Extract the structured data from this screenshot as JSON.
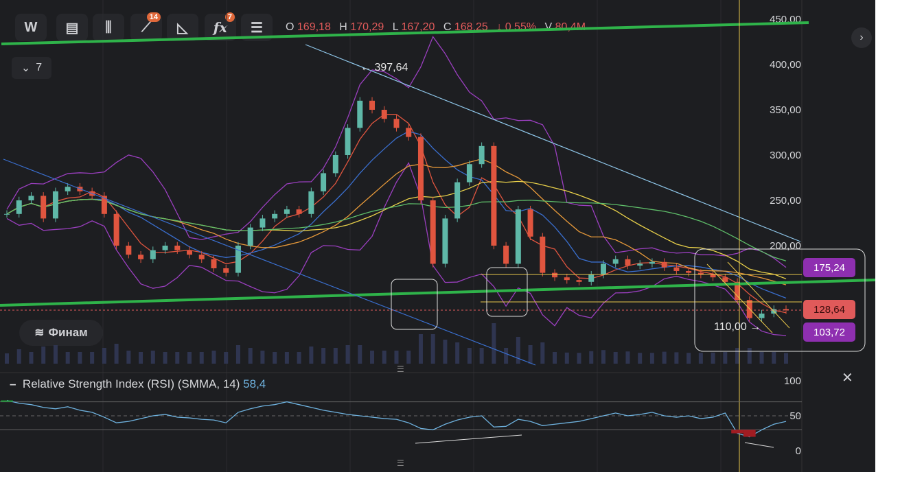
{
  "toolbar": {
    "interval": "W",
    "indicators_badge": "14",
    "fx_badge": "7"
  },
  "ohlc": {
    "o_label": "O",
    "o": "169,18",
    "h_label": "H",
    "h": "170,29",
    "l_label": "L",
    "l": "167,20",
    "c_label": "C",
    "c": "168,25",
    "change": "↓ 0,55%",
    "v_label": "V",
    "v": "80,4M"
  },
  "collapse": {
    "label": "7"
  },
  "logo": "Финам",
  "price_axis": [
    "450,00",
    "400,00",
    "350,00",
    "300,00",
    "250,00",
    "200,00"
  ],
  "price_tags": [
    {
      "value": "175,24",
      "color": "#8e2fb0"
    },
    {
      "value": "128,64",
      "color": "#e05a5a"
    },
    {
      "value": "103,72",
      "color": "#8e2fb0"
    }
  ],
  "annotations": {
    "high": "← 397,64",
    "low": "110,00 →"
  },
  "rsi": {
    "title": "Relative Strength Index (RSI) (SMMA, 14)",
    "value": "58,4",
    "axis": [
      "100",
      "50",
      "0"
    ]
  },
  "chart_data": {
    "type": "candlestick",
    "title": "",
    "ylim": [
      100,
      450
    ],
    "closes": [
      235,
      250,
      255,
      230,
      260,
      265,
      260,
      255,
      235,
      200,
      190,
      185,
      195,
      200,
      195,
      190,
      185,
      175,
      170,
      200,
      220,
      230,
      235,
      240,
      235,
      260,
      280,
      300,
      330,
      360,
      350,
      340,
      330,
      320,
      250,
      180,
      230,
      270,
      290,
      310,
      200,
      180,
      240,
      210,
      170,
      165,
      162,
      160,
      168,
      180,
      185,
      178,
      180,
      182,
      176,
      172,
      170,
      168,
      165,
      160,
      140,
      120,
      125,
      130,
      128.64
    ],
    "rsi_values": [
      72,
      68,
      66,
      62,
      60,
      63,
      58,
      55,
      48,
      40,
      42,
      46,
      50,
      52,
      48,
      47,
      45,
      44,
      40,
      55,
      60,
      64,
      66,
      70,
      66,
      62,
      58,
      55,
      52,
      50,
      48,
      46,
      45,
      40,
      32,
      30,
      38,
      44,
      48,
      50,
      34,
      35,
      45,
      42,
      36,
      38,
      40,
      42,
      46,
      50,
      54,
      50,
      52,
      55,
      50,
      48,
      50,
      46,
      48,
      54,
      25,
      20,
      30,
      38,
      42
    ]
  }
}
